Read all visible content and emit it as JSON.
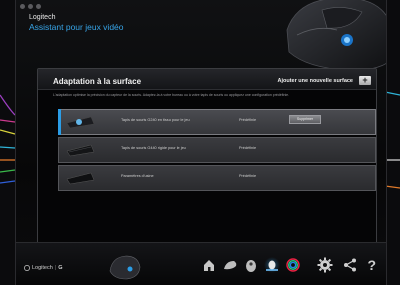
{
  "app": {
    "company": "Logitech",
    "title": "Assistant pour jeux vidéo"
  },
  "panel": {
    "title": "Adaptation à la surface",
    "add_label": "Ajouter une nouvelle surface",
    "add_button": "+",
    "description": "L'adaptation optimise la précision du capteur de la souris. Adaptez-la à votre bureau ou à votre tapis de souris ou appliquez une configuration prédéfinie."
  },
  "surfaces": [
    {
      "name": "Tapis de souris G240 en tissu pour le jeu",
      "status": "Prédéfinie",
      "action": "Supprimer",
      "selected": true
    },
    {
      "name": "Tapis de souris G440 rigide pour le jeu",
      "status": "Prédéfinie",
      "selected": false
    },
    {
      "name": "Paramètres d'usine",
      "status": "Prédéfinie",
      "selected": false
    }
  ],
  "footer": {
    "brand": "Logitech",
    "brand_mark": "G",
    "nav_icons": [
      "home-icon",
      "pointer-settings-icon",
      "mouse-sensor-icon",
      "surface-tuning-icon",
      "lighting-icon"
    ],
    "tool_icons": [
      "settings-gear-icon",
      "share-icon",
      "help-icon"
    ],
    "help_glyph": "?"
  },
  "colors": {
    "accent": "#2b9de6",
    "title_blue": "#37a5e8"
  }
}
